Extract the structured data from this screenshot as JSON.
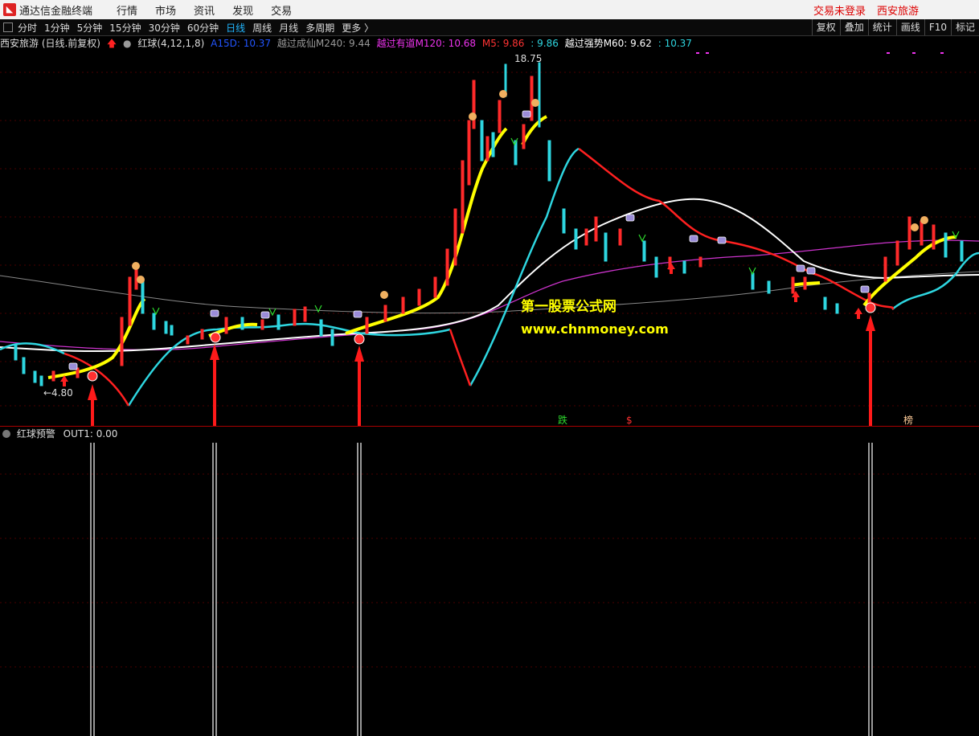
{
  "app": {
    "name": "通达信金融终端",
    "menu": [
      "行情",
      "市场",
      "资讯",
      "发现",
      "交易"
    ],
    "login_status": "交易未登录",
    "stock": "西安旅游"
  },
  "periods": {
    "items": [
      "分时",
      "1分钟",
      "5分钟",
      "15分钟",
      "30分钟",
      "60分钟",
      "日线",
      "周线",
      "月线",
      "多周期",
      "更多 〉"
    ],
    "active": "日线"
  },
  "tools": [
    "复权",
    "叠加",
    "统计",
    "画线",
    "F10",
    "标记"
  ],
  "info": {
    "title": "西安旅游 (日线.前复权)",
    "indicator": "红球(4,12,1,8)",
    "a15d": "A15D: 10.37",
    "m240": "越过成仙M240: 9.44",
    "m120": "越过有道M120: 10.68",
    "m5": "M5: 9.86",
    "blank": ": 9.86",
    "m60": "越过强势M60: 9.62",
    "blank2": ": 10.37"
  },
  "price_labels": {
    "high": "18.75",
    "low": "←4.80"
  },
  "markers": {
    "die": "跌",
    "s": "$",
    "bang": "榜"
  },
  "watermark": {
    "line1": "第一股票公式网",
    "line2": "www.chnmoney.com"
  },
  "indicator_panel": {
    "name": "红球预警",
    "value": "OUT1: 0.00"
  },
  "colors": {
    "up": "#ff2a2a",
    "down": "#2ed6e0",
    "yellow": "#ffff00",
    "white": "#ffffff",
    "magenta": "#cc33cc",
    "accent": "#22b7ff"
  }
}
